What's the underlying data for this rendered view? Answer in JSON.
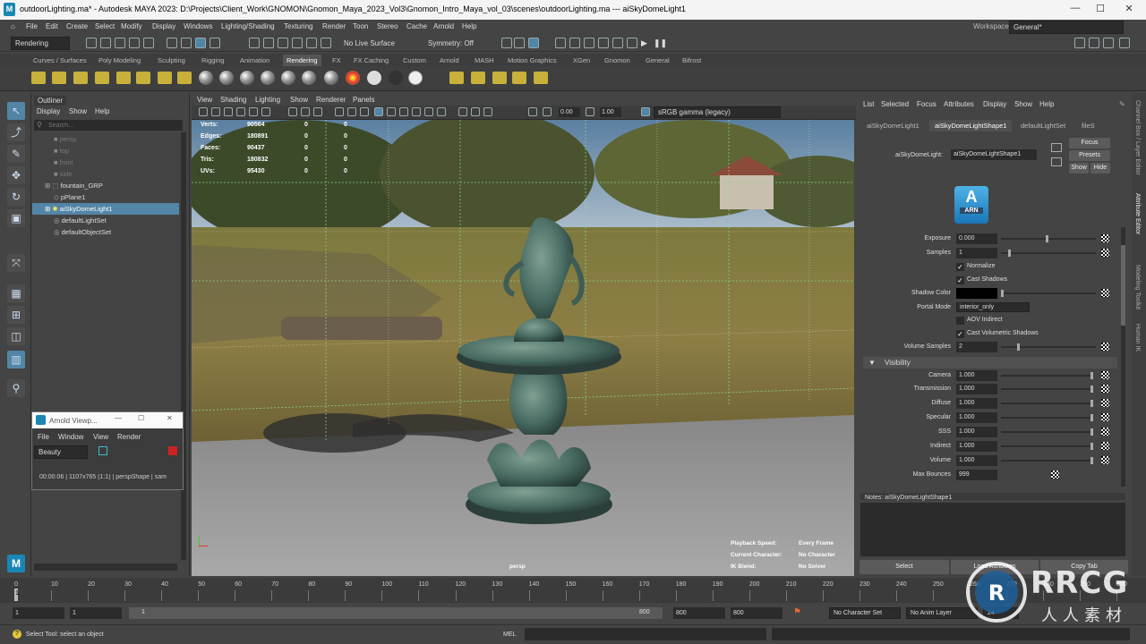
{
  "window": {
    "title": "outdoorLighting.ma* - Autodesk MAYA 2023: D:\\Projects\\Client_Work\\GNOMON\\Gnomon_Maya_2023_Vol3\\Gnomon_Intro_Maya_vol_03\\scenes\\outdoorLighting.ma  ---  aiSkyDomeLight1",
    "minimize": "—",
    "maximize": "☐",
    "close": "✕"
  },
  "menubar": {
    "items": [
      "File",
      "Edit",
      "Create",
      "Select",
      "Modify",
      "Display",
      "Windows",
      "Lighting/Shading",
      "Texturing",
      "Render",
      "Toon",
      "Stereo",
      "Cache",
      "Arnold",
      "Help"
    ],
    "workspace_label": "Workspace:",
    "workspace_value": "General*"
  },
  "statusline": {
    "menuset": "Rendering",
    "live_surface": "No Live Surface",
    "symmetry": "Symmetry: Off"
  },
  "shelf_tabs": [
    "Curves / Surfaces",
    "Poly Modeling",
    "Sculpting",
    "Rigging",
    "Animation",
    "Rendering",
    "FX",
    "FX Caching",
    "Custom",
    "Arnold",
    "MASH",
    "Motion Graphics",
    "XGen",
    "Gnomon",
    "General",
    "Bifrost"
  ],
  "shelf_active": "Rendering",
  "outliner": {
    "tab": "Outliner",
    "menu": [
      "Display",
      "Show",
      "Help"
    ],
    "search_placeholder": "Search...",
    "items": [
      {
        "label": "persp",
        "state": "dim"
      },
      {
        "label": "top",
        "state": "dim"
      },
      {
        "label": "front",
        "state": "dim"
      },
      {
        "label": "side",
        "state": "dim"
      },
      {
        "label": "fountain_GRP",
        "state": "normal"
      },
      {
        "label": "pPlane1",
        "state": "normal"
      },
      {
        "label": "aiSkyDomeLight1",
        "state": "selected"
      },
      {
        "label": "defaultLightSet",
        "state": "normal"
      },
      {
        "label": "defaultObjectSet",
        "state": "normal"
      }
    ]
  },
  "arnold_viewer": {
    "title": "Arnold Viewp...",
    "menu": [
      "File",
      "Window",
      "View",
      "Render"
    ],
    "aov": "Beauty",
    "status": "00:00:06 | 1107x765 (1:1) | perspShape  | sam"
  },
  "viewport": {
    "menu": [
      "View",
      "Shading",
      "Lighting",
      "Show",
      "Renderer",
      "Panels"
    ],
    "exposure": "0.00",
    "gamma": "1.00",
    "color_space": "sRGB gamma (legacy)",
    "stats": [
      {
        "label": "Verts:",
        "a": "90564",
        "b": "0",
        "c": "0"
      },
      {
        "label": "Edges:",
        "a": "180891",
        "b": "0",
        "c": "0"
      },
      {
        "label": "Faces:",
        "a": "90437",
        "b": "0",
        "c": "0"
      },
      {
        "label": "Tris:",
        "a": "180832",
        "b": "0",
        "c": "0"
      },
      {
        "label": "UVs:",
        "a": "95430",
        "b": "0",
        "c": "0"
      }
    ],
    "hud": [
      {
        "label": "Playback Speed:",
        "value": "Every Frame"
      },
      {
        "label": "Current Character:",
        "value": "No Character"
      },
      {
        "label": "IK Blend:",
        "value": "No Solver"
      }
    ],
    "camera": "persp"
  },
  "attribute_editor": {
    "menu": [
      "List",
      "Selected",
      "Focus",
      "Attributes",
      "Display",
      "Show",
      "Help"
    ],
    "tabs": [
      "aiSkyDomeLight1",
      "aiSkyDomeLightShape1",
      "defaultLightSet",
      "fileS"
    ],
    "node_label": "aiSkyDomeLight:",
    "node_value": "aiSkyDomeLightShape1",
    "focus": "Focus",
    "presets": "Presets",
    "show": "Show",
    "hide": "Hide",
    "arnold_badge": "ARN",
    "attrs": {
      "exposure_label": "Exposure",
      "exposure": "0.000",
      "samples_label": "Samples",
      "samples": "1",
      "normalize": "Normalize",
      "cast_shadows": "Cast Shadows",
      "shadow_color_label": "Shadow Color",
      "portal_mode_label": "Portal Mode",
      "portal_mode": "interior_only",
      "aov_indirect": "AOV Indirect",
      "cast_vol_shadows": "Cast Volumetric Shadows",
      "volume_samples_label": "Volume Samples",
      "volume_samples": "2"
    },
    "visibility_header": "Visibility",
    "visibility": [
      {
        "label": "Camera",
        "value": "1.000"
      },
      {
        "label": "Transmission",
        "value": "1.000"
      },
      {
        "label": "Diffuse",
        "value": "1.000"
      },
      {
        "label": "Specular",
        "value": "1.000"
      },
      {
        "label": "SSS",
        "value": "1.000"
      },
      {
        "label": "Indirect",
        "value": "1.000"
      },
      {
        "label": "Volume",
        "value": "1.000"
      }
    ],
    "max_bounces_label": "Max Bounces",
    "max_bounces": "999",
    "notes": "Notes:  aiSkyDomeLightShape1",
    "bottom_buttons": [
      "Select",
      "Load Attributes",
      "Copy Tab"
    ]
  },
  "right_strip": [
    "Channel Box / Layer Editor",
    "Attribute Editor",
    "Modeling Toolkit",
    "Human IK"
  ],
  "timeline": {
    "ticks": [
      "0",
      "10",
      "20",
      "30",
      "40",
      "50",
      "60",
      "70",
      "80",
      "90",
      "100",
      "110",
      "120",
      "130",
      "140",
      "150",
      "160",
      "170",
      "180",
      "190",
      "200",
      "210",
      "220",
      "230",
      "240",
      "250",
      "260",
      "270",
      "280",
      "290",
      "300"
    ],
    "current": "1"
  },
  "range": {
    "start": "1",
    "start2": "1",
    "slider_start": "1",
    "slider_end": "800",
    "end": "800",
    "end2": "800",
    "character": "No Character Set",
    "anim_layer": "No Anim Layer",
    "fps": "24"
  },
  "helpline": {
    "text": "Select Tool: select an object",
    "mel": "MEL"
  },
  "watermark": {
    "brand": "RRCG",
    "sub": "人人素材"
  }
}
